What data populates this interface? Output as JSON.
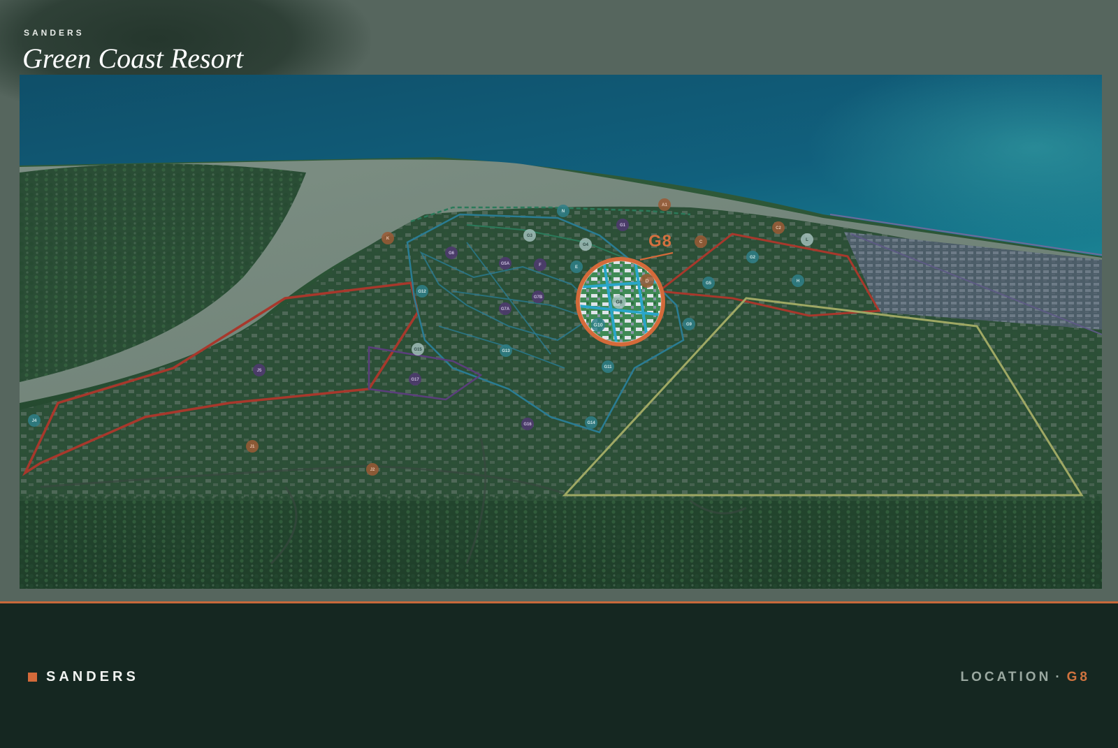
{
  "header": {
    "eyebrow": "SANDERS",
    "title": "Green Coast Resort"
  },
  "map": {
    "focus_label": "G8",
    "zone_markers": [
      {
        "label": "N",
        "color": "teal"
      },
      {
        "label": "G3",
        "color": "light"
      },
      {
        "label": "G4",
        "color": "light"
      },
      {
        "label": "G1",
        "color": "purple"
      },
      {
        "label": "G6",
        "color": "purple"
      },
      {
        "label": "G5A",
        "color": "purple"
      },
      {
        "label": "F",
        "color": "purple"
      },
      {
        "label": "E",
        "color": "teal"
      },
      {
        "label": "G7A",
        "color": "purple"
      },
      {
        "label": "G7B",
        "color": "purple"
      },
      {
        "label": "G12",
        "color": "teal"
      },
      {
        "label": "G13",
        "color": "teal"
      },
      {
        "label": "G15",
        "color": "light"
      },
      {
        "label": "G17",
        "color": "purple"
      },
      {
        "label": "G11",
        "color": "teal"
      },
      {
        "label": "G16",
        "color": "purple"
      },
      {
        "label": "G14",
        "color": "teal"
      },
      {
        "label": "G9",
        "color": "teal"
      },
      {
        "label": "J5",
        "color": "purple"
      },
      {
        "label": "J4",
        "color": "teal"
      },
      {
        "label": "J1",
        "color": "orange"
      },
      {
        "label": "J2",
        "color": "orange"
      },
      {
        "label": "K",
        "color": "orange"
      },
      {
        "label": "A1",
        "color": "orange"
      },
      {
        "label": "C",
        "color": "orange"
      },
      {
        "label": "C2",
        "color": "orange"
      },
      {
        "label": "L",
        "color": "light"
      },
      {
        "label": "G2",
        "color": "teal"
      },
      {
        "label": "H",
        "color": "teal"
      },
      {
        "label": "G5",
        "color": "teal"
      }
    ],
    "inset_markers": [
      {
        "label": "D",
        "color": "orange"
      },
      {
        "label": "G8",
        "color": "light"
      },
      {
        "label": "G10",
        "color": "teal"
      }
    ],
    "colors": {
      "accent": "#d46a3a",
      "zone_red": "#a8382c",
      "zone_yellow": "#9fa864",
      "zone_blue": "#2a7c93",
      "zone_purple": "#5b3e7c",
      "zone_green": "#2b7a5a"
    }
  },
  "footer": {
    "brand": "SANDERS",
    "location_label": "LOCATION",
    "separator": "·",
    "location_code": "G8"
  }
}
